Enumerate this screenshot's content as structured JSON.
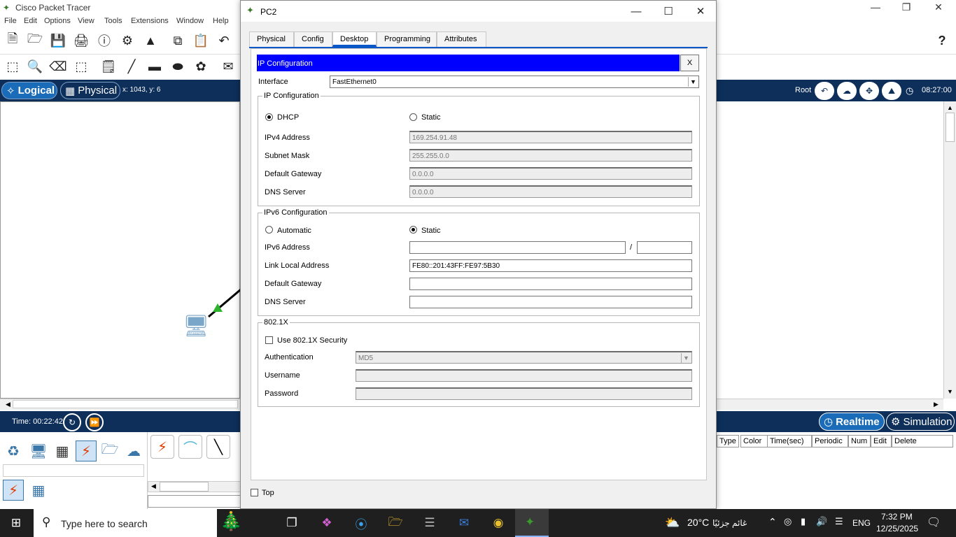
{
  "app": {
    "title": "Cisco Packet Tracer",
    "menu": [
      "File",
      "Edit",
      "Options",
      "View",
      "Tools",
      "Extensions",
      "Window",
      "Help"
    ],
    "help_glyph": "?",
    "mode_logical": "Logical",
    "mode_physical": "Physical",
    "coords": "x: 1043, y: 6",
    "root_label": "Root",
    "clock": "08:27:00",
    "time_label": "Time: 00:22:42",
    "realtime_label": "Realtime",
    "simulation_label": "Simulation",
    "pdu_headers": [
      "Type",
      "Color",
      "Time(sec)",
      "Periodic",
      "Num",
      "Edit",
      "Delete"
    ]
  },
  "dialog": {
    "title": "PC2",
    "tabs": [
      "Physical",
      "Config",
      "Desktop",
      "Programming",
      "Attributes"
    ],
    "active_tab": "Desktop",
    "ipcfg_header": "IP Configuration",
    "close_x": "X",
    "interface_label": "Interface",
    "interface_value": "FastEthernet0",
    "ipv4": {
      "group_title": "IP Configuration",
      "dhcp_label": "DHCP",
      "static_label": "Static",
      "selected": "DHCP",
      "ipv4_label": "IPv4 Address",
      "ipv4_value": "169.254.91.48",
      "mask_label": "Subnet Mask",
      "mask_value": "255.255.0.0",
      "gateway_label": "Default Gateway",
      "gateway_value": "0.0.0.0",
      "dns_label": "DNS Server",
      "dns_value": "0.0.0.0"
    },
    "ipv6": {
      "group_title": "IPv6 Configuration",
      "automatic_label": "Automatic",
      "static_label": "Static",
      "selected": "Static",
      "ipv6_label": "IPv6 Address",
      "ipv6_value": "",
      "prefix_sep": "/",
      "prefix_value": "",
      "linklocal_label": "Link Local Address",
      "linklocal_value": "FE80::201:43FF:FE97:5B30",
      "gateway_label": "Default Gateway",
      "gateway_value": "",
      "dns_label": "DNS Server",
      "dns_value": ""
    },
    "dot1x": {
      "group_title": "802.1X",
      "use_label": "Use 802.1X Security",
      "auth_label": "Authentication",
      "auth_value": "MD5",
      "username_label": "Username",
      "username_value": "",
      "password_label": "Password",
      "password_value": ""
    },
    "top_label": "Top"
  },
  "taskbar": {
    "search_placeholder": "Type here to search",
    "weather_temp": "20°C",
    "weather_text": "غائم جزئيًا",
    "lang": "ENG",
    "time": "7:32 PM",
    "date": "12/25/2025"
  },
  "colors": {
    "ipcfg_bar": "#0000ff",
    "modebar": "#0d2f5a",
    "active_tab_underline": "#0a57c7"
  }
}
